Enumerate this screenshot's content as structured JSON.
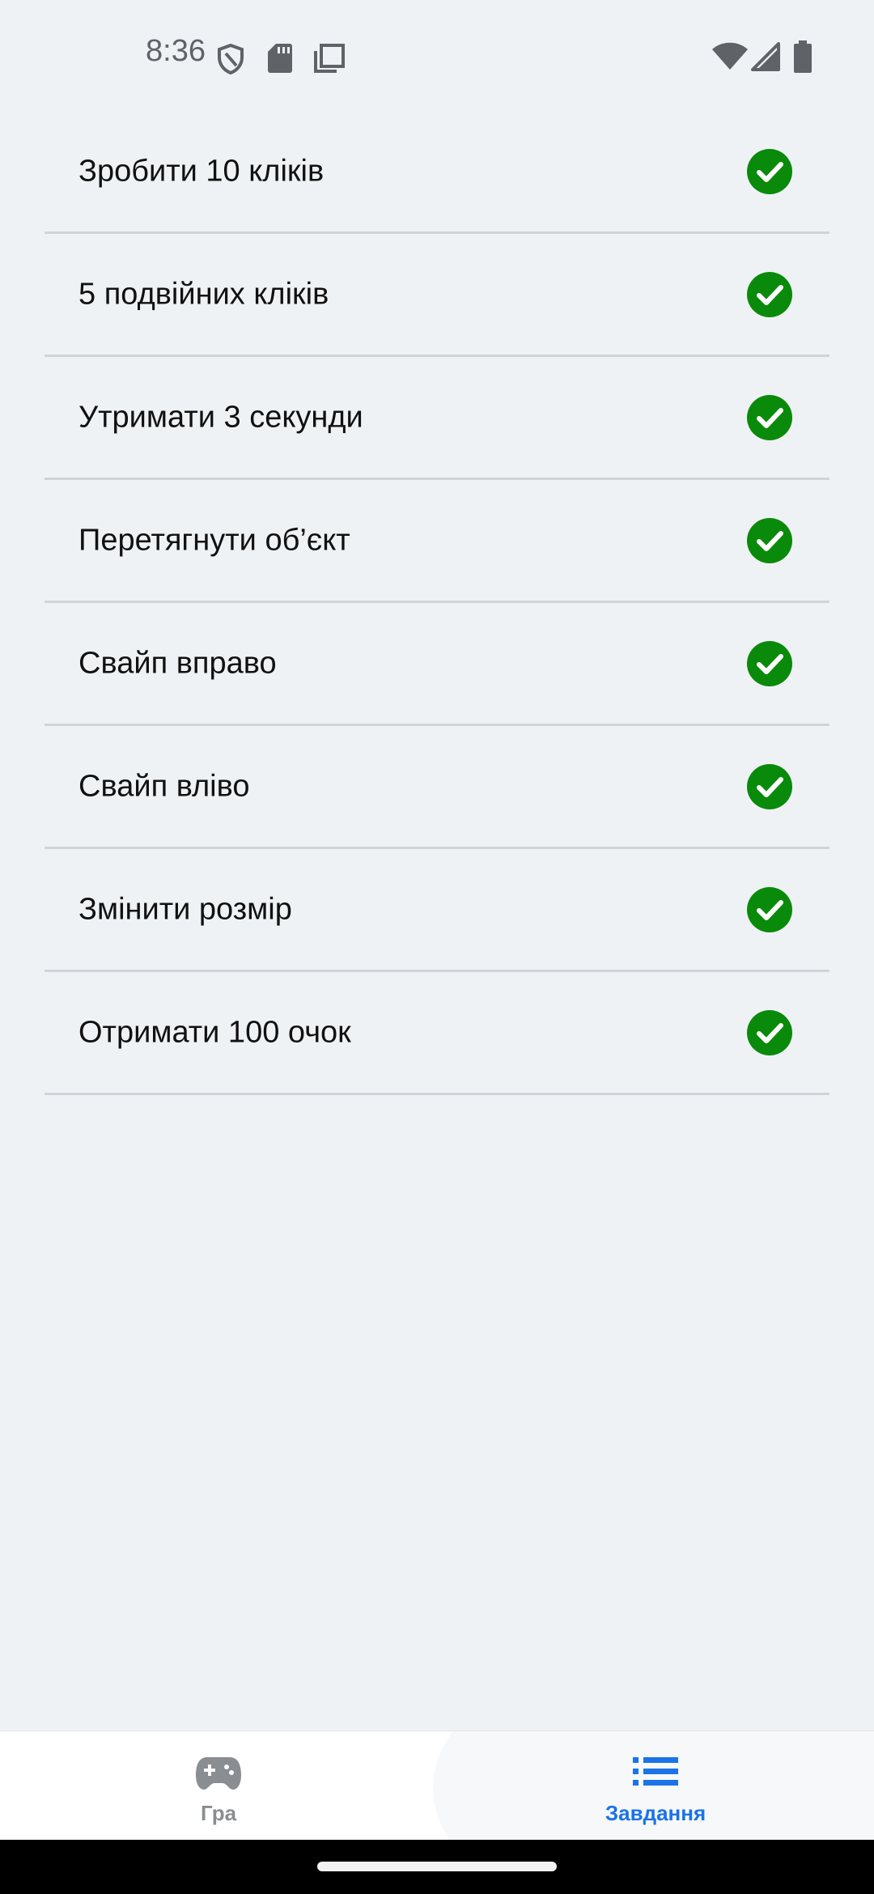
{
  "status_bar": {
    "time": "8:36",
    "icons": [
      "shield-icon",
      "sd-card-icon",
      "screenshot-icon",
      "wifi-icon",
      "cellular-icon",
      "battery-icon"
    ]
  },
  "tasks": [
    {
      "label": "Зробити 10 кліків",
      "done": true
    },
    {
      "label": "5 подвійних кліків",
      "done": true
    },
    {
      "label": "Утримати 3 секунди",
      "done": true
    },
    {
      "label": "Перетягнути об’єкт",
      "done": true
    },
    {
      "label": "Свайп вправо",
      "done": true
    },
    {
      "label": "Свайп вліво",
      "done": true
    },
    {
      "label": "Змінити розмір",
      "done": true
    },
    {
      "label": "Отримати 100 очок",
      "done": true
    }
  ],
  "bottom_nav": {
    "items": [
      {
        "label": "Гра",
        "icon": "gamepad-icon",
        "selected": false
      },
      {
        "label": "Завдання",
        "icon": "list-icon",
        "selected": true
      }
    ]
  },
  "colors": {
    "background": "#eff2f5",
    "check": "#0a8a0a",
    "accent": "#1a73e8",
    "inactive": "#8a8d91"
  }
}
